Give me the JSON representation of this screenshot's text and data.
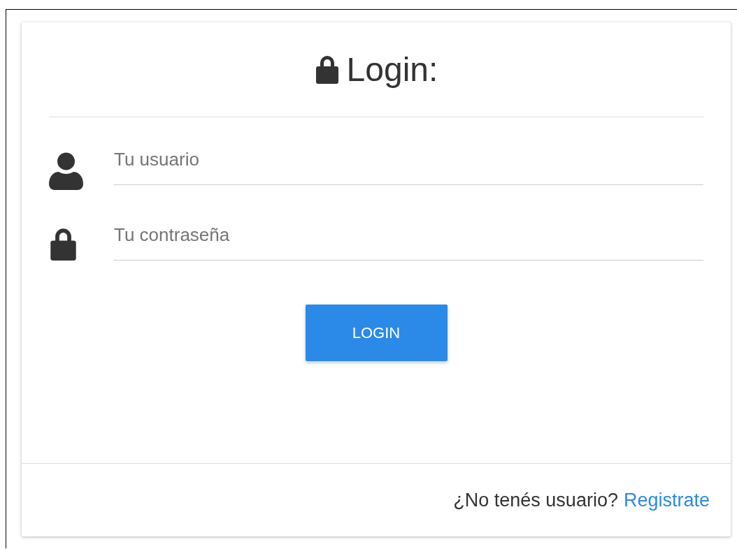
{
  "title": "Login:",
  "fields": [
    {
      "kind": "user",
      "placeholder": "Tu usuario"
    },
    {
      "kind": "password",
      "placeholder": "Tu contraseña"
    }
  ],
  "button": "LOGIN",
  "footer": {
    "text": "¿No tenés usuario?",
    "link": "Registrate"
  }
}
